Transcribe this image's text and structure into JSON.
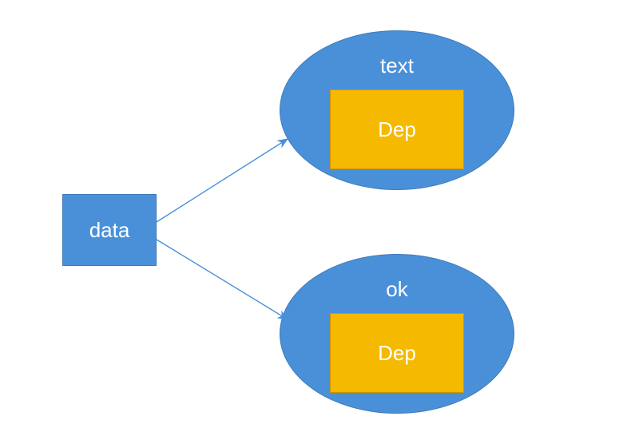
{
  "diagram": {
    "source": {
      "label": "data"
    },
    "targets": [
      {
        "title": "text",
        "inner_label": "Dep"
      },
      {
        "title": "ok",
        "inner_label": "Dep"
      }
    ],
    "colors": {
      "blue": "#4a90d9",
      "blue_border": "#3d7bb8",
      "yellow": "#f5b900",
      "yellow_border": "#c79600",
      "arrow": "#4a90d9"
    }
  }
}
